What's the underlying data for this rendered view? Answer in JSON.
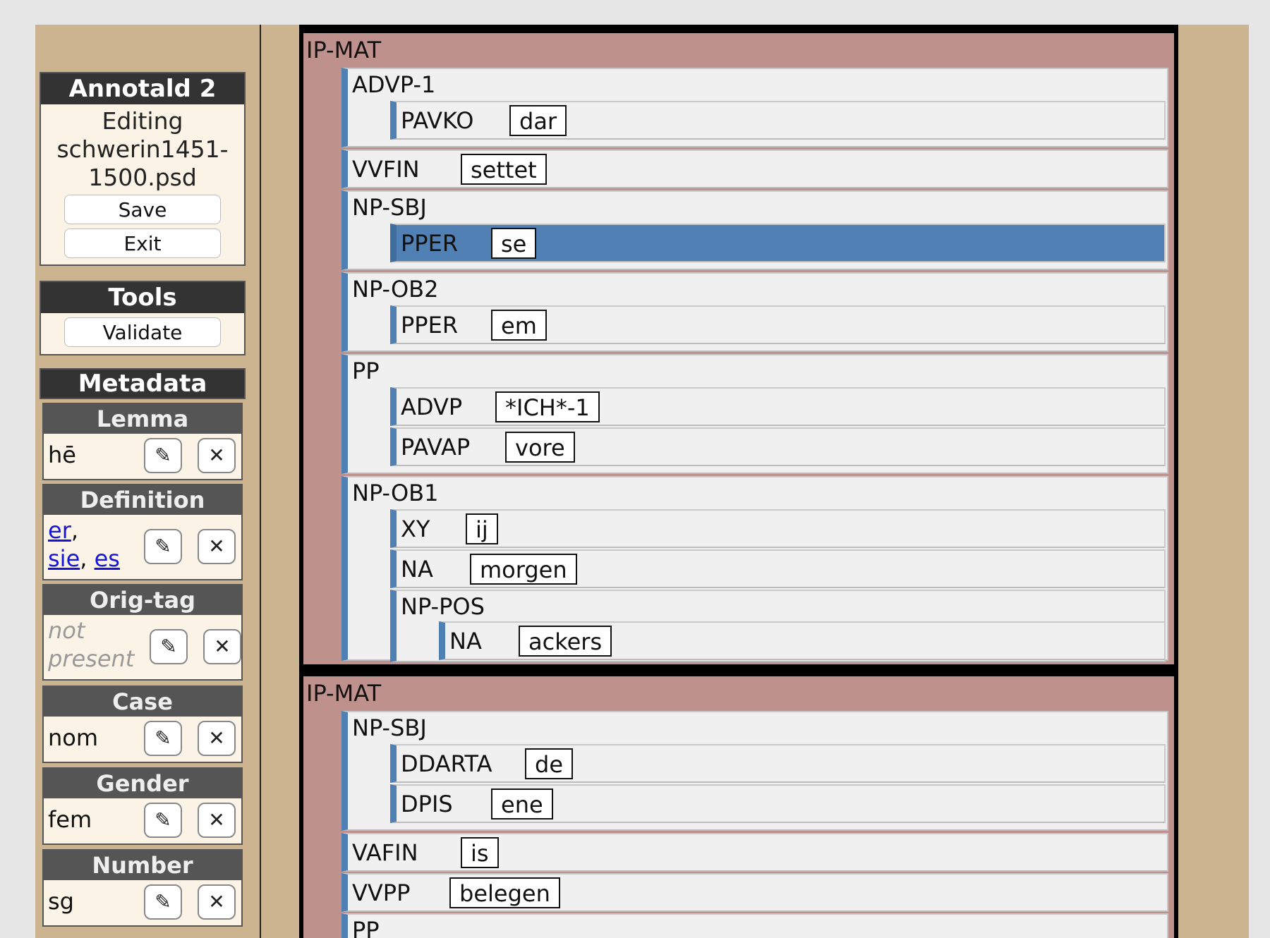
{
  "app": {
    "title": "Annotald 2"
  },
  "file": {
    "editing_label": "Editing",
    "filename": "schwerin1451-1500.psd"
  },
  "actions": {
    "save": "Save",
    "exit": "Exit"
  },
  "tools": {
    "title": "Tools",
    "validate": "Validate"
  },
  "metadata": {
    "title": "Metadata",
    "edit_glyph": "✎",
    "delete_glyph": "✕",
    "lemma": {
      "label": "Lemma",
      "value": "hē"
    },
    "definition": {
      "label": "Definition",
      "links": [
        "er",
        "sie",
        "es"
      ],
      "sep": ","
    },
    "origtag": {
      "label": "Orig-tag",
      "value": "not present"
    },
    "case": {
      "label": "Case",
      "value": "nom"
    },
    "gender": {
      "label": "Gender",
      "value": "fem"
    },
    "number": {
      "label": "Number",
      "value": "sg"
    }
  },
  "tree": {
    "sentence1": {
      "label": "IP-MAT",
      "advp1": {
        "label": "ADVP-1",
        "child": {
          "tag": "PAVKO",
          "word": "dar"
        }
      },
      "vvfin": {
        "tag": "VVFIN",
        "word": "settet"
      },
      "npsbj": {
        "label": "NP-SBJ",
        "child": {
          "tag": "PPER",
          "word": "se"
        }
      },
      "npob2": {
        "label": "NP-OB2",
        "child": {
          "tag": "PPER",
          "word": "em"
        }
      },
      "pp": {
        "label": "PP",
        "advp": {
          "tag": "ADVP",
          "word": "*ICH*-1"
        },
        "pavap": {
          "tag": "PAVAP",
          "word": "vore"
        }
      },
      "npob1": {
        "label": "NP-OB1",
        "xy": {
          "tag": "XY",
          "word": "ij"
        },
        "na": {
          "tag": "NA",
          "word": "morgen"
        },
        "nppos": {
          "label": "NP-POS",
          "child": {
            "tag": "NA",
            "word": "ackers"
          }
        }
      }
    },
    "sentence2": {
      "label": "IP-MAT",
      "npsbj": {
        "label": "NP-SBJ",
        "ddarta": {
          "tag": "DDARTA",
          "word": "de"
        },
        "dpis": {
          "tag": "DPIS",
          "word": "ene"
        }
      },
      "vafin": {
        "tag": "VAFIN",
        "word": "is"
      },
      "vvpp": {
        "tag": "VVPP",
        "word": "belegen"
      },
      "pp": {
        "label": "PP"
      }
    }
  }
}
